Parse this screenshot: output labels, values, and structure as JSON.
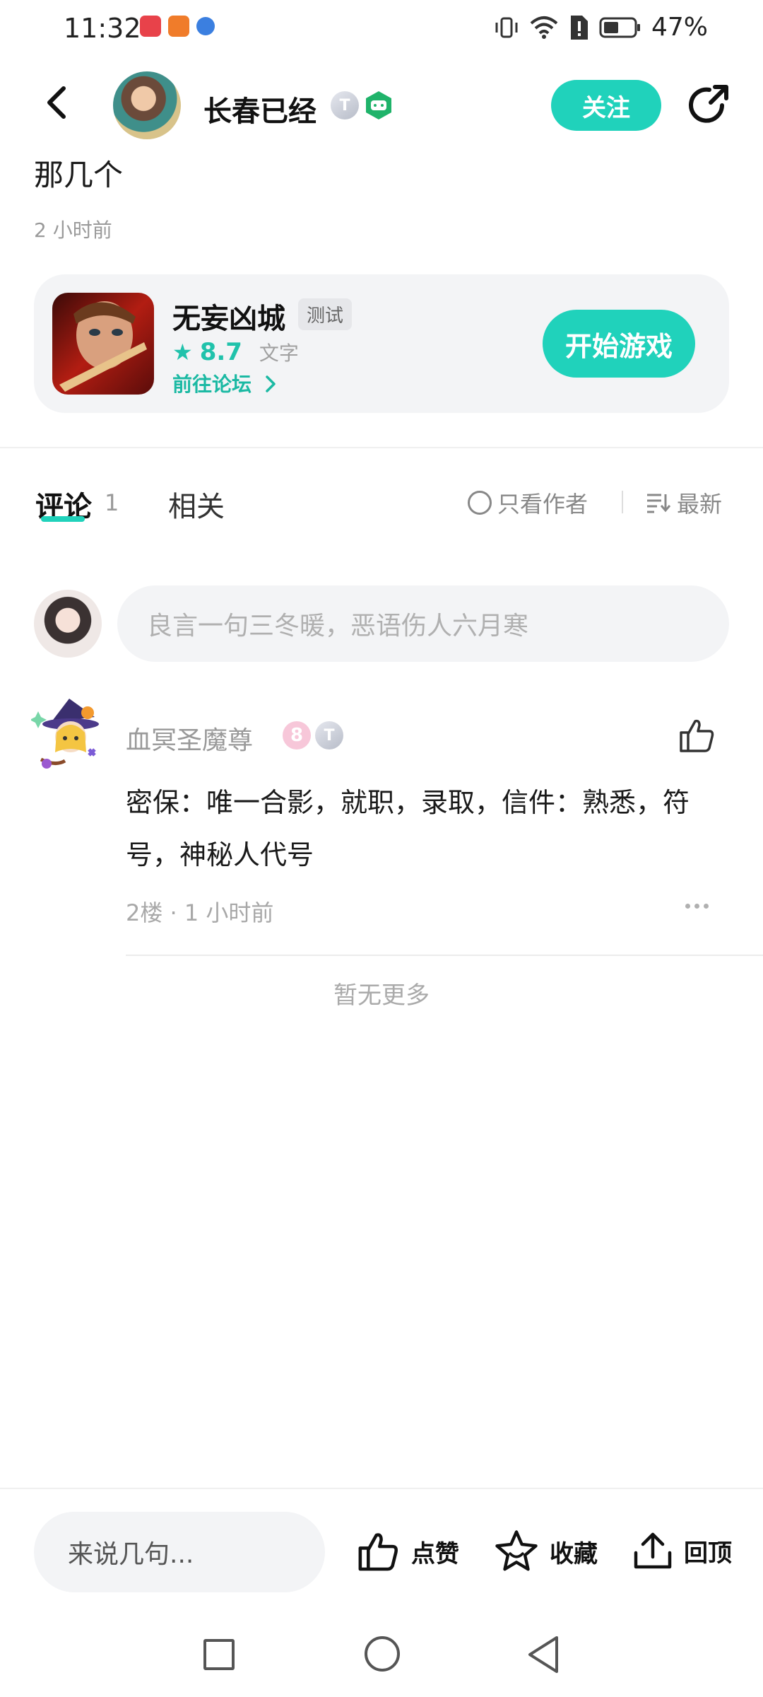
{
  "status_bar": {
    "time": "11:32",
    "battery": "47%"
  },
  "header": {
    "author_name": "长春已经",
    "badge_t": "T",
    "follow_label": "关注"
  },
  "post": {
    "text": "那几个",
    "time": "2 小时前"
  },
  "game_card": {
    "name": "无妄凶城",
    "tag": "测试",
    "rating": "8.7",
    "type": "文字",
    "forum_link": "前往论坛",
    "start_label": "开始游戏"
  },
  "tabs": {
    "comments_label": "评论",
    "comments_count": "1",
    "related_label": "相关",
    "author_only_label": "只看作者",
    "sort_label": "最新"
  },
  "comment_input": {
    "placeholder": "良言一句三冬暖，恶语伤人六月寒"
  },
  "comments": [
    {
      "name": "血冥圣魔尊",
      "badge_level": "8",
      "badge_t": "T",
      "text": "密保：唯一合影，就职，录取，信件：熟悉，符号，神秘人代号",
      "meta": "2楼 · 1 小时前"
    }
  ],
  "list_end": "暂无更多",
  "bottom_bar": {
    "input_placeholder": "来说几句...",
    "like_label": "点赞",
    "favorite_label": "收藏",
    "top_label": "回顶"
  },
  "colors": {
    "accent": "#20d2bb",
    "accent_text": "#1bb9a3"
  },
  "icons": [
    "back-icon",
    "share-icon",
    "star-icon",
    "chevron-right-icon",
    "circle-icon",
    "sort-icon",
    "thumbs-up-icon",
    "more-icon",
    "favorite-icon",
    "upload-icon"
  ]
}
